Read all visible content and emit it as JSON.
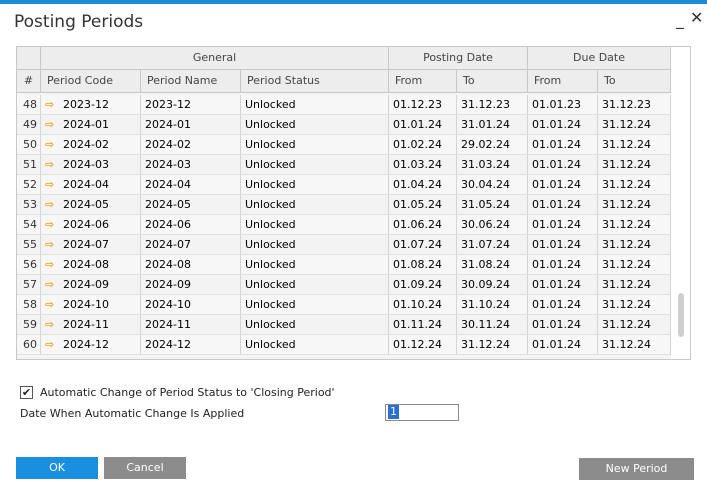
{
  "window": {
    "title": "Posting Periods",
    "minimize": "_",
    "close": "✕"
  },
  "grid": {
    "group_headers": [
      "General",
      "Posting Date",
      "Due Date"
    ],
    "columns": [
      "#",
      "Period Code",
      "Period Name",
      "Period Status",
      "From",
      "To",
      "From",
      "To"
    ],
    "rows": [
      {
        "num": "48",
        "code": "2023-12",
        "name": "2023-12",
        "status": "Unlocked",
        "pfrom": "01.12.23",
        "pto": "31.12.23",
        "dfrom": "01.01.23",
        "dto": "31.12.23"
      },
      {
        "num": "49",
        "code": "2024-01",
        "name": "2024-01",
        "status": "Unlocked",
        "pfrom": "01.01.24",
        "pto": "31.01.24",
        "dfrom": "01.01.24",
        "dto": "31.12.24"
      },
      {
        "num": "50",
        "code": "2024-02",
        "name": "2024-02",
        "status": "Unlocked",
        "pfrom": "01.02.24",
        "pto": "29.02.24",
        "dfrom": "01.01.24",
        "dto": "31.12.24"
      },
      {
        "num": "51",
        "code": "2024-03",
        "name": "2024-03",
        "status": "Unlocked",
        "pfrom": "01.03.24",
        "pto": "31.03.24",
        "dfrom": "01.01.24",
        "dto": "31.12.24"
      },
      {
        "num": "52",
        "code": "2024-04",
        "name": "2024-04",
        "status": "Unlocked",
        "pfrom": "01.04.24",
        "pto": "30.04.24",
        "dfrom": "01.01.24",
        "dto": "31.12.24"
      },
      {
        "num": "53",
        "code": "2024-05",
        "name": "2024-05",
        "status": "Unlocked",
        "pfrom": "01.05.24",
        "pto": "31.05.24",
        "dfrom": "01.01.24",
        "dto": "31.12.24"
      },
      {
        "num": "54",
        "code": "2024-06",
        "name": "2024-06",
        "status": "Unlocked",
        "pfrom": "01.06.24",
        "pto": "30.06.24",
        "dfrom": "01.01.24",
        "dto": "31.12.24"
      },
      {
        "num": "55",
        "code": "2024-07",
        "name": "2024-07",
        "status": "Unlocked",
        "pfrom": "01.07.24",
        "pto": "31.07.24",
        "dfrom": "01.01.24",
        "dto": "31.12.24"
      },
      {
        "num": "56",
        "code": "2024-08",
        "name": "2024-08",
        "status": "Unlocked",
        "pfrom": "01.08.24",
        "pto": "31.08.24",
        "dfrom": "01.01.24",
        "dto": "31.12.24"
      },
      {
        "num": "57",
        "code": "2024-09",
        "name": "2024-09",
        "status": "Unlocked",
        "pfrom": "01.09.24",
        "pto": "30.09.24",
        "dfrom": "01.01.24",
        "dto": "31.12.24"
      },
      {
        "num": "58",
        "code": "2024-10",
        "name": "2024-10",
        "status": "Unlocked",
        "pfrom": "01.10.24",
        "pto": "31.10.24",
        "dfrom": "01.01.24",
        "dto": "31.12.24"
      },
      {
        "num": "59",
        "code": "2024-11",
        "name": "2024-11",
        "status": "Unlocked",
        "pfrom": "01.11.24",
        "pto": "30.11.24",
        "dfrom": "01.01.24",
        "dto": "31.12.24"
      },
      {
        "num": "60",
        "code": "2024-12",
        "name": "2024-12",
        "status": "Unlocked",
        "pfrom": "01.12.24",
        "pto": "31.12.24",
        "dfrom": "01.01.24",
        "dto": "31.12.24"
      }
    ]
  },
  "options": {
    "auto_change_label": "Automatic Change of Period Status to 'Closing Period'",
    "auto_change_checked": true,
    "date_applied_label": "Date When Automatic Change Is Applied",
    "date_applied_value": "1"
  },
  "buttons": {
    "ok": "OK",
    "cancel": "Cancel",
    "new_period": "New Period"
  },
  "colors": {
    "accent": "#1a8fe0",
    "secondary_button": "#8c8c8c",
    "link_arrow": "#f2a11a"
  },
  "icons": {
    "row_link": "link-arrow-icon",
    "expand": "expand-icon"
  }
}
